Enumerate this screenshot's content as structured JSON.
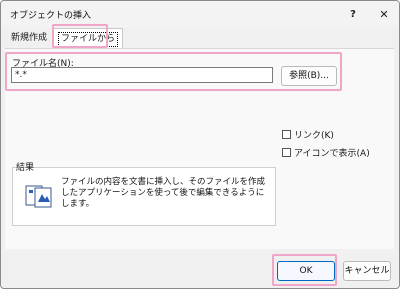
{
  "window": {
    "title": "オブジェクトの挿入",
    "help_label": "?",
    "close_label": "✕"
  },
  "tabs": [
    {
      "label": "新規作成"
    },
    {
      "label": "ファイルから"
    }
  ],
  "file": {
    "label": "ファイル名(N):",
    "value": "*.*",
    "browse_label": "参照(B)..."
  },
  "options": {
    "link_label": "リンク(K)",
    "show_as_icon_label": "アイコンで表示(A)"
  },
  "result": {
    "group_label": "結果",
    "text": "ファイルの内容を文書に挿入し、そのファイルを作成したアプリケーションを使って後で編集できるようにします。",
    "icon": "document-icon"
  },
  "buttons": {
    "ok_label": "OK",
    "cancel_label": "キャンセル"
  },
  "colors": {
    "highlight": "#f0a6c8",
    "ok_border": "#0067c0"
  }
}
